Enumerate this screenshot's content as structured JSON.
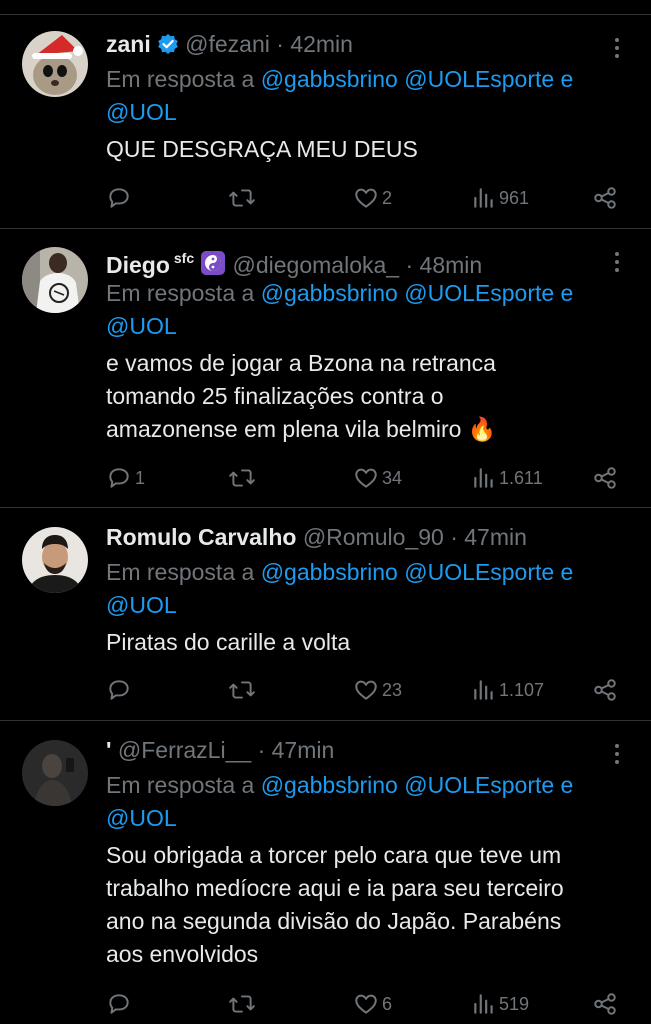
{
  "tweets": [
    {
      "name": "zani",
      "handle": "@fezani",
      "time": "42min",
      "reply_prefix": "Em resposta a",
      "reply_users": [
        "@gabbsbrino",
        "@UOLEsporte",
        "e",
        "@UOL"
      ],
      "text": "QUE DESGRAÇA MEU DEUS",
      "replies": "",
      "retweets": "",
      "likes": "2",
      "views": "961",
      "avatar": "cat-with-santa-hat"
    },
    {
      "name": "Diego",
      "name_sup": "sfc",
      "handle": "@diegomaloka_",
      "time": "48min",
      "reply_prefix": "Em resposta a",
      "reply_users": [
        "@gabbsbrino",
        "@UOLEsporte",
        "e",
        "@UOL"
      ],
      "text_lines": [
        "e vamos de jogar a Bzona na retranca",
        "tomando 25 finalizações contra o",
        "amazonense em plena vila belmiro 🔥"
      ],
      "replies": "1",
      "retweets": "",
      "likes": "34",
      "views": "1.611",
      "avatar": "person-in-santos-shirt"
    },
    {
      "name": "Romulo Carvalho",
      "handle": "@Romulo_90",
      "time": "47min",
      "reply_prefix": "Em resposta a",
      "reply_users": [
        "@gabbsbrino",
        "@UOLEsporte",
        "e",
        "@UOL"
      ],
      "text": "Piratas do carille a volta",
      "replies": "",
      "retweets": "",
      "likes": "23",
      "views": "1.107",
      "avatar": "man-portrait"
    },
    {
      "name": "'",
      "handle": "@FerrazLi__",
      "time": "47min",
      "reply_prefix": "Em resposta a",
      "reply_users": [
        "@gabbsbrino",
        "@UOLEsporte",
        "e",
        "@UOL"
      ],
      "text_lines": [
        "Sou obrigada a torcer pelo cara que teve um",
        "trabalho medíocre aqui e ia para seu terceiro",
        "ano na segunda divisão do Japão. Parabéns",
        "aos envolvidos"
      ],
      "replies": "",
      "retweets": "",
      "likes": "6",
      "views": "519",
      "avatar": "dark-selfie"
    }
  ],
  "separator": "·",
  "colors": {
    "background": "#000000",
    "text": "#e7e9ea",
    "muted": "#71767b",
    "link": "#1d9bf0",
    "divider": "#2f3336",
    "verified": "#1d9bf0"
  }
}
